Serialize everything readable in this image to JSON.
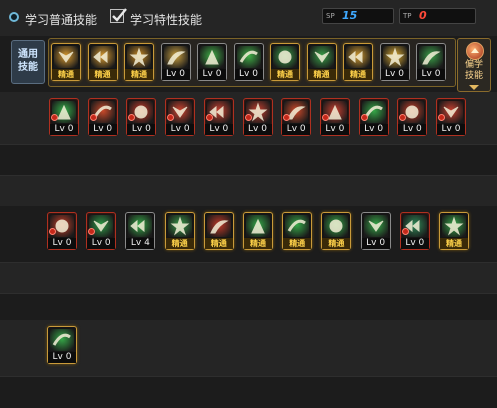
{
  "tabs": {
    "normal_skills_label": "学习普通技能",
    "trait_skills_label": "学习特性技能"
  },
  "points": {
    "sp_tag": "SP",
    "sp_value": "15",
    "tp_tag": "TP",
    "tp_value": "0",
    "sp_color": "#3fa9ff",
    "tp_color": "#ff4a3a"
  },
  "common_skills": {
    "label_line1": "通用",
    "label_line2": "技能",
    "items": [
      {
        "name": "skill-sit-rest",
        "level": "精通",
        "master": true,
        "style": "gold",
        "color": "#d89a30"
      },
      {
        "name": "skill-quick-rebound",
        "level": "精通",
        "master": true,
        "style": "gold",
        "color": "#d89a30"
      },
      {
        "name": "skill-leap",
        "level": "精通",
        "master": true,
        "style": "gold",
        "color": "#c98c26"
      },
      {
        "name": "skill-wings",
        "level": "Lv 0",
        "master": false,
        "style": "grey",
        "color": "#c9a040"
      },
      {
        "name": "skill-target-1",
        "level": "Lv 0",
        "master": false,
        "style": "grey",
        "color": "#3fae46"
      },
      {
        "name": "skill-target-2",
        "level": "Lv 0",
        "master": false,
        "style": "grey",
        "color": "#3fae46"
      },
      {
        "name": "skill-summon-beast",
        "level": "精通",
        "master": true,
        "style": "gold",
        "color": "#3aa048"
      },
      {
        "name": "skill-kneel",
        "level": "精通",
        "master": true,
        "style": "gold",
        "color": "#3aa048"
      },
      {
        "name": "skill-eye",
        "level": "精通",
        "master": true,
        "style": "gold",
        "color": "#d09a30"
      },
      {
        "name": "skill-power-up",
        "level": "Lv 0",
        "master": false,
        "style": "grey",
        "color": "#d8a830"
      },
      {
        "name": "skill-nature",
        "level": "Lv 0",
        "master": false,
        "style": "grey",
        "color": "#3aa048"
      }
    ]
  },
  "side_button": {
    "line1": "偏学",
    "line2": "技能"
  },
  "row_two": [
    {
      "name": "skill-kick",
      "level": "Lv 0",
      "master": false,
      "style": "red",
      "color": "#36b04a"
    },
    {
      "name": "skill-slash",
      "level": "Lv 0",
      "master": false,
      "style": "red",
      "color": "#c94a2a"
    },
    {
      "name": "skill-whirl",
      "level": "Lv 0",
      "master": false,
      "style": "red",
      "color": "#c93a2a"
    },
    {
      "name": "skill-arrows",
      "level": "Lv 0",
      "master": false,
      "style": "red",
      "color": "#d04430"
    },
    {
      "name": "skill-rush",
      "level": "Lv 0",
      "master": false,
      "style": "red",
      "color": "#c84030"
    },
    {
      "name": "skill-guard",
      "level": "Lv 0",
      "master": false,
      "style": "red",
      "color": "#c94030"
    },
    {
      "name": "skill-flame-cut",
      "level": "Lv 0",
      "master": false,
      "style": "red",
      "color": "#d04a2a"
    },
    {
      "name": "skill-cyclone",
      "level": "Lv 0",
      "master": false,
      "style": "red",
      "color": "#c94030"
    },
    {
      "name": "skill-crescent",
      "level": "Lv 0",
      "master": false,
      "style": "red",
      "color": "#36a848"
    },
    {
      "name": "skill-burst",
      "level": "Lv 0",
      "master": false,
      "style": "red",
      "color": "#c8402a"
    },
    {
      "name": "skill-storm",
      "level": "Lv 0",
      "master": false,
      "style": "red",
      "color": "#c94030"
    }
  ],
  "row_three": [
    {
      "name": "skill-tornado",
      "level": "Lv 0",
      "master": false,
      "style": "red",
      "color": "#c9402a"
    },
    {
      "name": "skill-wind-blade",
      "level": "Lv 0",
      "master": false,
      "style": "red",
      "color": "#2f9c48"
    },
    {
      "name": "skill-grass",
      "level": "Lv 4",
      "master": false,
      "style": "grey",
      "color": "#36a848"
    },
    {
      "name": "skill-spin",
      "level": "精通",
      "master": true,
      "style": "gold",
      "color": "#3a9c48"
    },
    {
      "name": "skill-bell",
      "level": "精通",
      "master": true,
      "style": "gold",
      "color": "#c03a28"
    },
    {
      "name": "skill-split",
      "level": "精通",
      "master": true,
      "style": "gold",
      "color": "#36a848"
    },
    {
      "name": "skill-vortex",
      "level": "精通",
      "master": true,
      "style": "gold",
      "color": "#36a848"
    },
    {
      "name": "skill-uppercut",
      "level": "精通",
      "master": true,
      "style": "gold",
      "color": "#36a848"
    },
    {
      "name": "skill-shield-wave",
      "level": "Lv 0",
      "master": false,
      "style": "grey",
      "color": "#36a848"
    },
    {
      "name": "skill-crane",
      "level": "Lv 0",
      "master": false,
      "style": "red",
      "color": "#2f8a58"
    },
    {
      "name": "skill-spirit",
      "level": "精通",
      "master": true,
      "style": "gold",
      "color": "#36a848"
    }
  ],
  "row_four": [
    {
      "name": "skill-curve-slash",
      "level": "Lv 0",
      "master": false,
      "style": "gold",
      "color": "#36a848"
    }
  ]
}
